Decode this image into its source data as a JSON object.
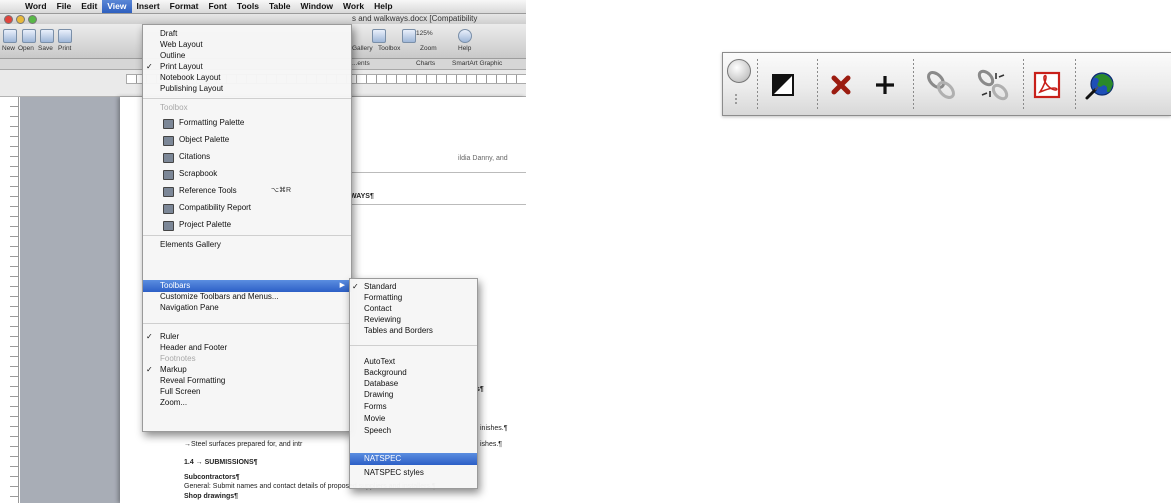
{
  "word_window": {
    "menubar": {
      "apple_glyph": "",
      "items": [
        "Word",
        "File",
        "Edit",
        "View",
        "Insert",
        "Format",
        "Font",
        "Tools",
        "Table",
        "Window",
        "Work",
        "Help"
      ],
      "active": "View"
    },
    "document_title": "s and walkways.docx [Compatibility",
    "toolbar_labels": [
      "New",
      "Open",
      "Save",
      "Print",
      "Gallery",
      "Toolbox",
      "Zoom",
      "Help"
    ],
    "zoom_value": "125%",
    "ribbon_tabs": [
      "...ents",
      "Charts",
      "SmartArt Graphic"
    ],
    "document_lines": [
      "ildia Danny, and",
      "WAYS¶",
      "s¶",
      "inishes.¶",
      "ishes.¶",
      "→Steel surfaces prepared for, and intr",
      "1.4 → SUBMISSIONS¶",
      "Subcontractors¶",
      "General: Submit names and contact details of proposed suppliers and installers.¶",
      "Shop drawings¶"
    ]
  },
  "view_menu": {
    "items": [
      {
        "label": "Draft",
        "checked": false
      },
      {
        "label": "Web Layout",
        "checked": false
      },
      {
        "label": "Outline",
        "checked": false
      },
      {
        "label": "Print Layout",
        "checked": true
      },
      {
        "label": "Notebook Layout",
        "checked": false
      },
      {
        "label": "Publishing Layout",
        "checked": false
      }
    ],
    "toolbox_header": "Toolbox",
    "toolbox_items": [
      {
        "label": "Formatting Palette",
        "shortcut": ""
      },
      {
        "label": "Object Palette",
        "shortcut": ""
      },
      {
        "label": "Citations",
        "shortcut": ""
      },
      {
        "label": "Scrapbook",
        "shortcut": ""
      },
      {
        "label": "Reference Tools",
        "shortcut": "⌥⌘R"
      },
      {
        "label": "Compatibility Report",
        "shortcut": ""
      },
      {
        "label": "Project Palette",
        "shortcut": ""
      }
    ],
    "group3": [
      {
        "label": "Elements Gallery"
      },
      {
        "label": "Toolbars",
        "highlighted": true,
        "submenu_arrow": "▶"
      },
      {
        "label": "Customize Toolbars and Menus..."
      },
      {
        "label": "Navigation Pane"
      }
    ],
    "group4": [
      {
        "label": "Ruler",
        "checked": true
      },
      {
        "label": "Header and Footer",
        "checked": false
      },
      {
        "label": "Footnotes",
        "checked": false,
        "disabled": true
      },
      {
        "label": "Markup",
        "checked": true
      },
      {
        "label": "Reveal Formatting",
        "checked": false
      },
      {
        "label": "Full Screen",
        "checked": false
      },
      {
        "label": "Zoom...",
        "checked": false
      }
    ],
    "check_glyph": "✓"
  },
  "toolbars_submenu": {
    "group1": [
      {
        "label": "Standard",
        "checked": true
      },
      {
        "label": "Formatting",
        "checked": false
      },
      {
        "label": "Contact",
        "checked": false
      },
      {
        "label": "Reviewing",
        "checked": false
      },
      {
        "label": "Tables and Borders",
        "checked": false
      }
    ],
    "group2": [
      {
        "label": "AutoText"
      },
      {
        "label": "Background"
      },
      {
        "label": "Database"
      },
      {
        "label": "Drawing"
      },
      {
        "label": "Forms"
      },
      {
        "label": "Movie"
      },
      {
        "label": "Speech"
      },
      {
        "label": "NATSPEC",
        "highlighted": true
      },
      {
        "label": "NATSPEC styles"
      }
    ]
  },
  "natspec_toolbar": {
    "buttons": [
      {
        "icon": "toggle-contrast-icon",
        "color": "#111111"
      },
      {
        "icon": "delete-x-icon",
        "color": "#9b1c10"
      },
      {
        "icon": "add-plus-icon",
        "color": "#111111"
      },
      {
        "icon": "link-icon",
        "color": "#8a8a8a"
      },
      {
        "icon": "unlink-icon",
        "color": "#8a8a8a"
      },
      {
        "icon": "pdf-icon",
        "color": "#c8201a"
      },
      {
        "icon": "web-globe-icon",
        "color": "#2a7a2a"
      }
    ]
  },
  "colors": {
    "menu_highlight": "#2c5fc6",
    "sidebar_gutter": "#a8adb6"
  }
}
